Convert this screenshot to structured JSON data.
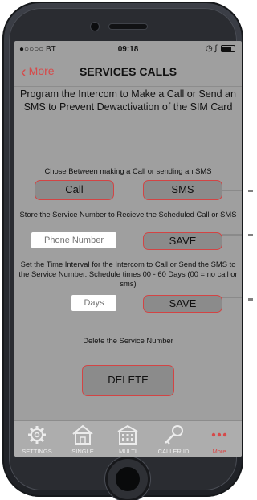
{
  "status_bar": {
    "carrier": "●○○○○ BT",
    "time": "09:18"
  },
  "nav": {
    "back_label": "More",
    "title": "SERVICES CALLS"
  },
  "intro_text": "Program the Intercom to Make a Call or Send an SMS to Prevent Dewactivation of the SIM Card",
  "choice": {
    "label": "Chose Between making a Call or sending an SMS",
    "call_label": "Call",
    "sms_label": "SMS"
  },
  "service_number": {
    "label": "Store the Service Number to Recieve the Scheduled Call or SMS",
    "placeholder": "Phone Number",
    "save_label": "SAVE"
  },
  "interval": {
    "label": "Set the Time Interval for the Intercom to Call or Send the SMS to the Service Number. Schedule times 00 - 60 Days (00 = no call or sms)",
    "placeholder": "Days",
    "save_label": "SAVE"
  },
  "delete_section": {
    "label": "Delete the Service Number",
    "button_label": "DELETE"
  },
  "tabs": [
    {
      "label": "SETTINGS",
      "icon": "gear-icon"
    },
    {
      "label": "SINGLE",
      "icon": "house-icon"
    },
    {
      "label": "MULTI",
      "icon": "building-icon"
    },
    {
      "label": "CALLER ID",
      "icon": "key-icon"
    },
    {
      "label": "More",
      "icon": "more-dots-icon",
      "active": true
    }
  ],
  "colors": {
    "accent": "#d64a4a",
    "screen_bg": "#9f9f9f",
    "button_bg": "#8b8b8b",
    "tabbar_bg": "#adadad"
  }
}
